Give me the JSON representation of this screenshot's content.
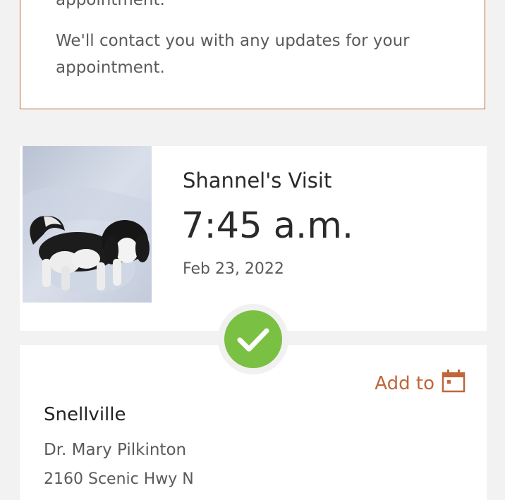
{
  "notice": {
    "line1": "appointment.",
    "line2": "We'll contact you with any updates for your appointment."
  },
  "visit": {
    "title": "Shannel's Visit",
    "time": "7:45 a.m.",
    "date": "Feb 23, 2022",
    "status_icon": "check-icon"
  },
  "location": {
    "add_to_label": "Add to",
    "calendar_icon": "calendar-icon",
    "name": "Snellville",
    "doctor": "Dr. Mary Pilkinton",
    "address": "2160 Scenic Hwy N"
  },
  "colors": {
    "accent": "#c0663a",
    "success": "#7ac043",
    "background": "#f2f2f2"
  }
}
